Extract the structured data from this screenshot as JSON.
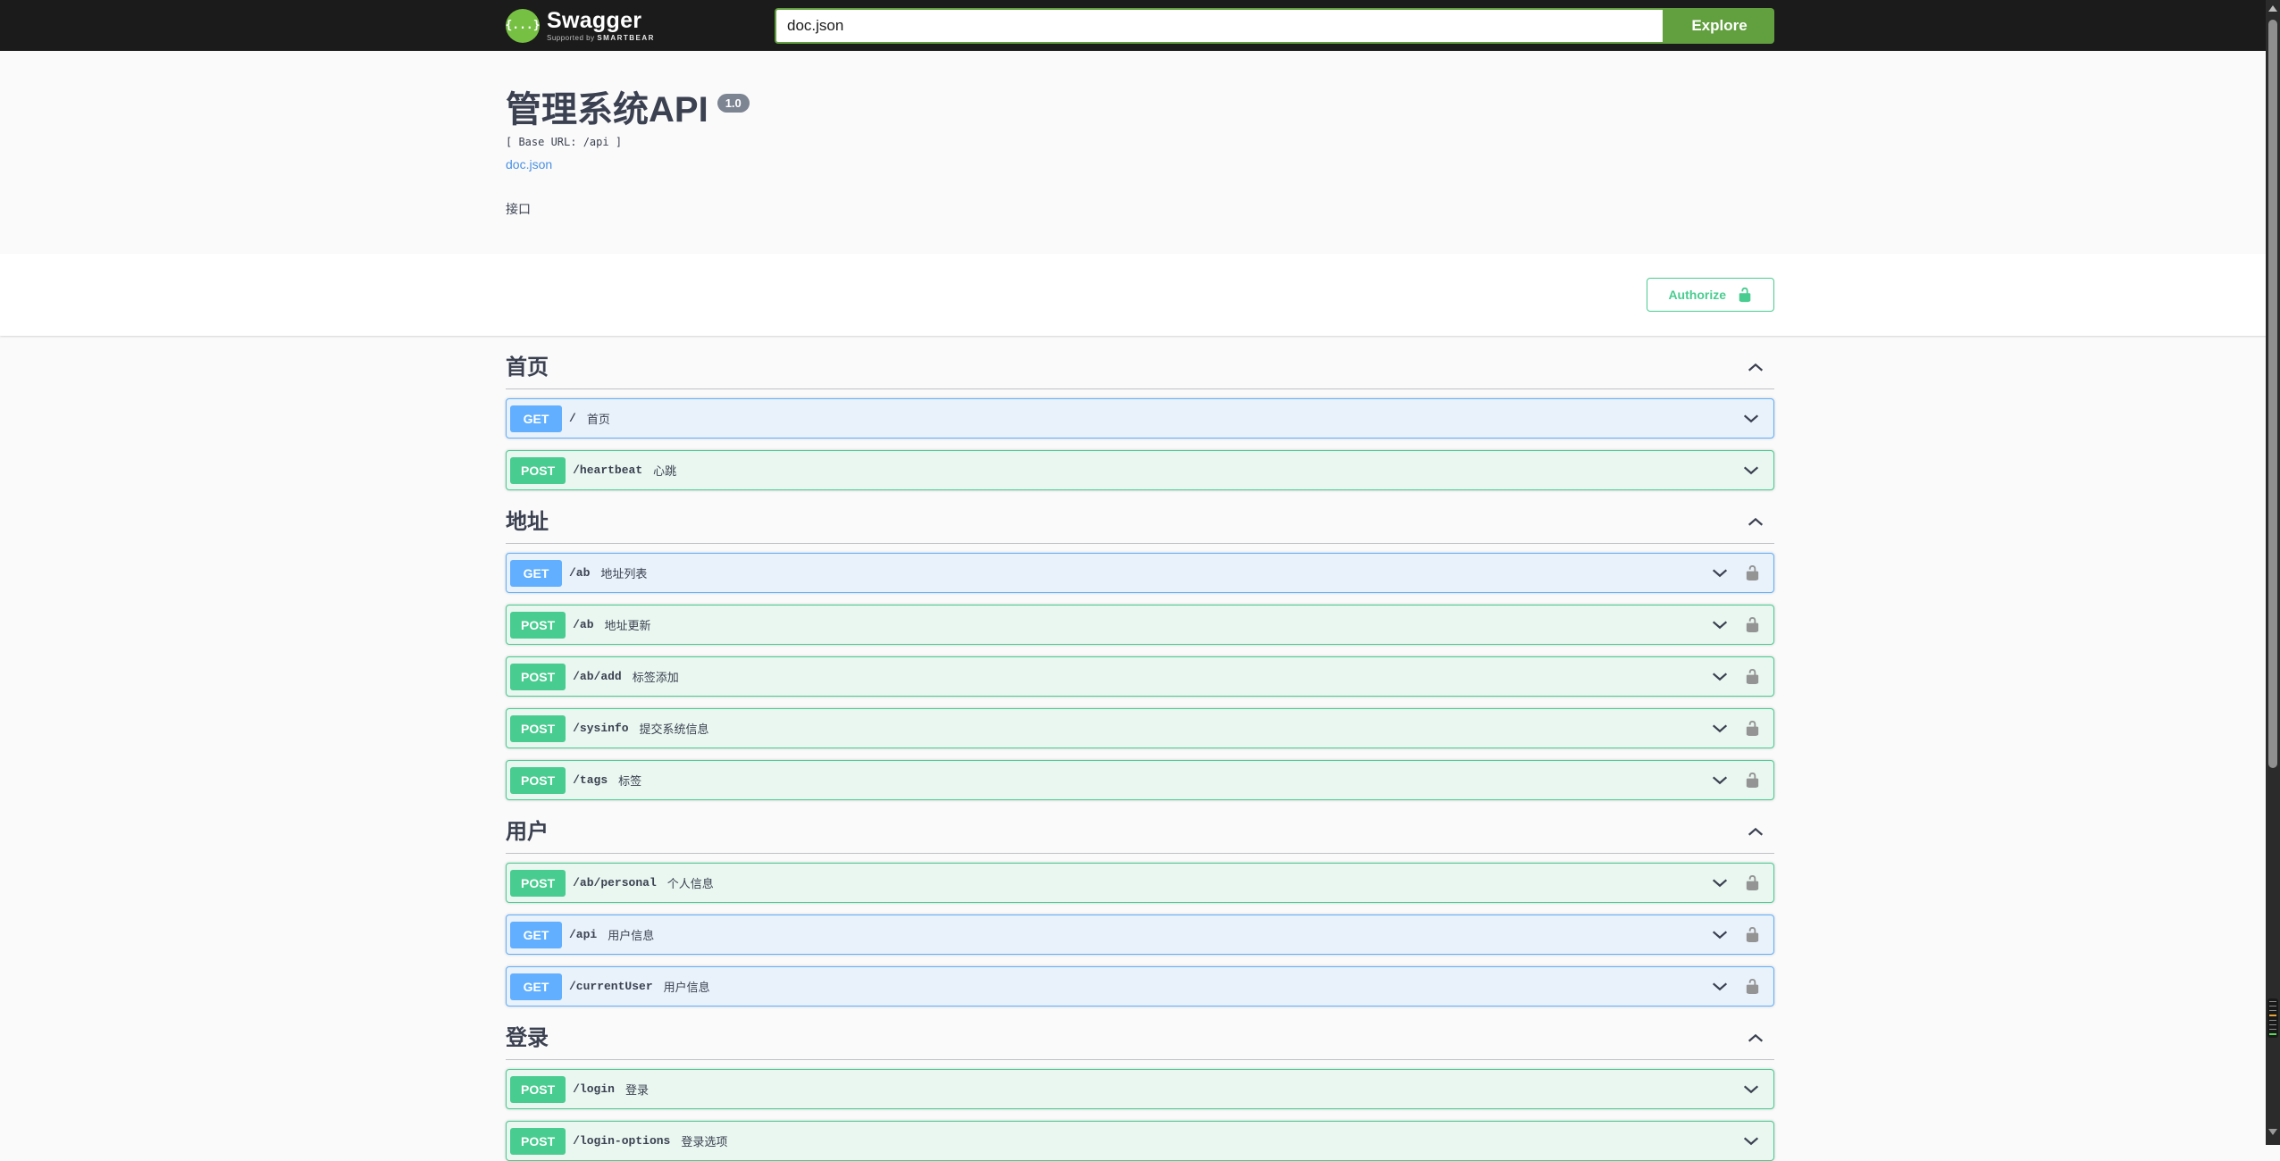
{
  "topbar": {
    "logo_text": "Swagger",
    "logo_tagline_prefix": "Supported by",
    "logo_tagline_brand": "SMARTBEAR",
    "logo_glyph": "{...}",
    "search_value": "doc.json",
    "explore_label": "Explore"
  },
  "info": {
    "title": "管理系统API",
    "version_badge": "1.0",
    "base_url": "[ Base URL: /api ]",
    "spec_link": "doc.json",
    "description": "接口"
  },
  "auth": {
    "authorize_label": "Authorize"
  },
  "sections": [
    {
      "title": "首页",
      "expanded": true,
      "operations": [
        {
          "method": "GET",
          "path": "/",
          "summary": "首页",
          "locked": false
        },
        {
          "method": "POST",
          "path": "/heartbeat",
          "summary": "心跳",
          "locked": false
        }
      ]
    },
    {
      "title": "地址",
      "expanded": true,
      "operations": [
        {
          "method": "GET",
          "path": "/ab",
          "summary": "地址列表",
          "locked": true
        },
        {
          "method": "POST",
          "path": "/ab",
          "summary": "地址更新",
          "locked": true
        },
        {
          "method": "POST",
          "path": "/ab/add",
          "summary": "标签添加",
          "locked": true
        },
        {
          "method": "POST",
          "path": "/sysinfo",
          "summary": "提交系统信息",
          "locked": true
        },
        {
          "method": "POST",
          "path": "/tags",
          "summary": "标签",
          "locked": true
        }
      ]
    },
    {
      "title": "用户",
      "expanded": true,
      "operations": [
        {
          "method": "POST",
          "path": "/ab/personal",
          "summary": "个人信息",
          "locked": true
        },
        {
          "method": "GET",
          "path": "/api",
          "summary": "用户信息",
          "locked": true
        },
        {
          "method": "GET",
          "path": "/currentUser",
          "summary": "用户信息",
          "locked": true
        }
      ]
    },
    {
      "title": "登录",
      "expanded": true,
      "operations": [
        {
          "method": "POST",
          "path": "/login",
          "summary": "登录",
          "locked": false
        },
        {
          "method": "POST",
          "path": "/login-options",
          "summary": "登录选项",
          "locked": false
        }
      ]
    }
  ],
  "colors": {
    "topbar_bg": "#1b1b1b",
    "explore_green": "#62a03f",
    "logo_green": "#76c043",
    "get_blue": "#61affe",
    "post_green": "#49cc90",
    "link_blue": "#4990e2",
    "text": "#3b4151",
    "version_badge_bg": "#7d8492",
    "lock_gray": "#949494",
    "page_bg": "#fafafa"
  }
}
